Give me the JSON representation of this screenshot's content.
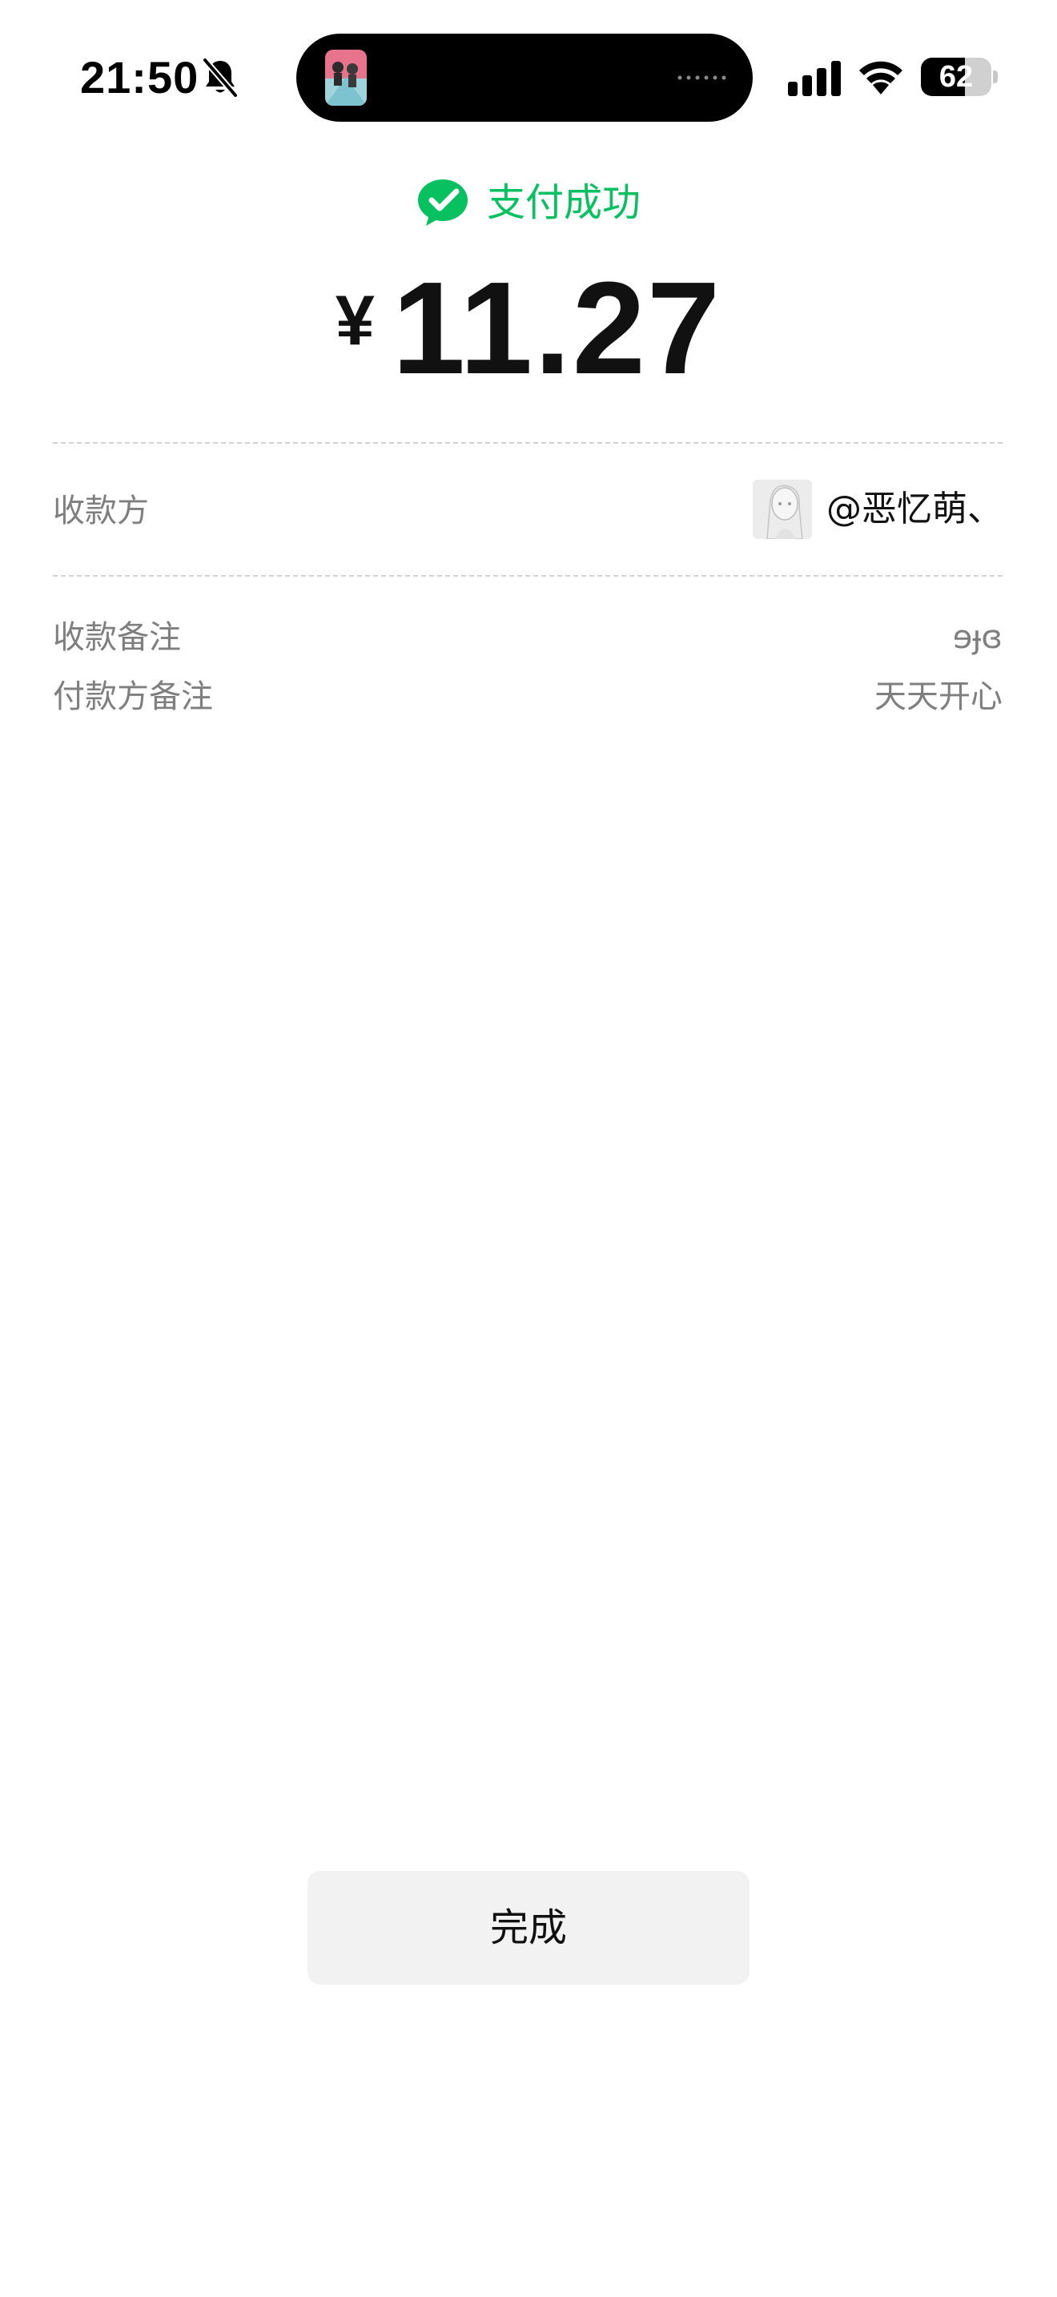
{
  "status_bar": {
    "time": "21:50",
    "battery_percent": "62",
    "battery_level": 0.62,
    "icons": [
      "bell-off-icon",
      "signal-icon",
      "wifi-icon",
      "battery-icon"
    ]
  },
  "payment": {
    "status_text": "支付成功",
    "status_color": "#07c160",
    "currency_symbol": "¥",
    "amount": "11.27"
  },
  "details": {
    "payee_label": "收款方",
    "payee_name": "@恶忆萌、",
    "payee_note_label": "收款备注",
    "payee_note_value": "ɘɟɞ",
    "payer_note_label": "付款方备注",
    "payer_note_value": "天天开心"
  },
  "actions": {
    "done_label": "完成"
  }
}
